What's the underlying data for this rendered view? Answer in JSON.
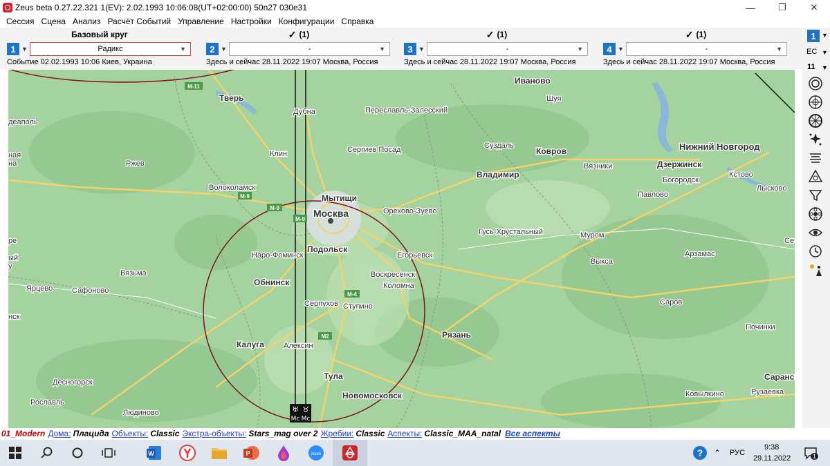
{
  "window": {
    "title": "Zeus beta  0.27.22.321  1(EV): 2.02.1993 10:06:08(UT+02:00:00) 50n27 030e31",
    "minimize": "—",
    "maximize": "❐",
    "close": "✕"
  },
  "menu": [
    "Сессия",
    "Сцена",
    "Анализ",
    "Расчёт Событий",
    "Управление",
    "Настройки",
    "Конфигурации",
    "Справка"
  ],
  "panels": [
    {
      "num": "1",
      "header": "Базовый круг",
      "check": "",
      "select": "Радикс",
      "event": "Событие 02.02.1993 10:06 Киев, Украина"
    },
    {
      "num": "2",
      "header": "(1)",
      "check": "✓",
      "select": "-",
      "event": "Здесь и сейчас 28.11.2022 19:07 Москва, Россия"
    },
    {
      "num": "3",
      "header": "(1)",
      "check": "✓",
      "select": "-",
      "event": "Здесь и сейчас 28.11.2022 19:07 Москва, Россия"
    },
    {
      "num": "4",
      "header": "(1)",
      "check": "✓",
      "select": "-",
      "event": "Здесь и сейчас 28.11.2022 19:07 Москва, Россия"
    }
  ],
  "sidebar": {
    "num": "1",
    "ec": "EC",
    "count": "11",
    "icons": [
      "rings-icon",
      "wheel-icon",
      "dharma-wheel-icon",
      "sparkle-icon",
      "lines-icon",
      "triangle-house-icon",
      "funnel-icon",
      "flower-icon",
      "eye-icon",
      "clock-icon",
      "sun-person-icon"
    ]
  },
  "map": {
    "cities": [
      {
        "name": "Тверь",
        "major": true
      },
      {
        "name": "Дубна",
        "major": false
      },
      {
        "name": "Переславль-Залесский",
        "major": false
      },
      {
        "name": "Иваново",
        "major": true
      },
      {
        "name": "Шуя",
        "major": false
      },
      {
        "name": "Сергиев Посад",
        "major": false
      },
      {
        "name": "Суздаль",
        "major": false
      },
      {
        "name": "Ковров",
        "major": true
      },
      {
        "name": "Нижний Новгород",
        "major": true
      },
      {
        "name": "Клин",
        "major": false
      },
      {
        "name": "Ржев",
        "major": false
      },
      {
        "name": "Владимир",
        "major": true
      },
      {
        "name": "Вязники",
        "major": false
      },
      {
        "name": "Дзержинск",
        "major": true
      },
      {
        "name": "Кстово",
        "major": false
      },
      {
        "name": "Богородск",
        "major": false
      },
      {
        "name": "Волоколамск",
        "major": false
      },
      {
        "name": "Мытищи",
        "major": true
      },
      {
        "name": "Москва",
        "major": true
      },
      {
        "name": "Орехово-Зуево",
        "major": false
      },
      {
        "name": "Павлово",
        "major": false
      },
      {
        "name": "Лысково",
        "major": false
      },
      {
        "name": "Гусь-Хрустальный",
        "major": false
      },
      {
        "name": "Муром",
        "major": false
      },
      {
        "name": "Подольск",
        "major": true
      },
      {
        "name": "Наро-Фоминск",
        "major": false
      },
      {
        "name": "Егорьевск",
        "major": false
      },
      {
        "name": "Выкса",
        "major": false
      },
      {
        "name": "Арзамас",
        "major": false
      },
      {
        "name": "Вязьма",
        "major": false
      },
      {
        "name": "Обнинск",
        "major": true
      },
      {
        "name": "Воскресенск",
        "major": false
      },
      {
        "name": "Коломна",
        "major": false
      },
      {
        "name": "Ярцево",
        "major": false
      },
      {
        "name": "Сафоново",
        "major": false
      },
      {
        "name": "Серпухов",
        "major": false
      },
      {
        "name": "Ступино",
        "major": false
      },
      {
        "name": "Саров",
        "major": false
      },
      {
        "name": "Почин­ки",
        "major": false
      },
      {
        "name": "Калуга",
        "major": true
      },
      {
        "name": "Алексин",
        "major": false
      },
      {
        "name": "Рязань",
        "major": true
      },
      {
        "name": "Тула",
        "major": true
      },
      {
        "name": "Десногорск",
        "major": false
      },
      {
        "name": "Новомосковск",
        "major": true
      },
      {
        "name": "Ковылкино",
        "major": false
      },
      {
        "name": "Рузаевка",
        "major": false
      },
      {
        "name": "Саранск",
        "major": true
      },
      {
        "name": "Рославль",
        "major": false
      },
      {
        "name": "Людиново",
        "major": false
      }
    ],
    "edge_labels": [
      "деаполь",
      "ная",
      "на",
      "ре",
      "ый",
      "у",
      "нск",
      "Се"
    ],
    "roads": [
      "M-11",
      "M-9",
      "M-9",
      "M-9",
      "M-4",
      "M2"
    ],
    "planet_labels": [
      {
        "glyph": "♅",
        "sub": "Mc"
      },
      {
        "glyph": "♉",
        "sub": "Mc"
      }
    ]
  },
  "status": {
    "profile": "01_Modern",
    "houses_label": "Дома:",
    "houses": "Плацида",
    "objects_label": "Объекты:",
    "objects": "Classic",
    "extra_label": "Экстра-объекты:",
    "extra": "Stars_mag over 2",
    "lots_label": "Жребии:",
    "lots": "Classic",
    "aspects_label": "Аспекты:",
    "aspects": "Classic_MAA_natal",
    "all_aspects": "Все аспекты"
  },
  "taskbar": {
    "lang": "РУС",
    "time": "9:38",
    "date": "29.11.2022",
    "notif": "1",
    "up_arrow": "⌃",
    "zoom_label": "zoom",
    "word_label": "W",
    "ppt_label": "P"
  },
  "colors": {
    "accent": "#1e73c8",
    "map_green": "#a4d3a0",
    "road_yellow": "#f3d36a",
    "circle_red": "#7a1020",
    "annotation_red": "#8b0a1a"
  }
}
